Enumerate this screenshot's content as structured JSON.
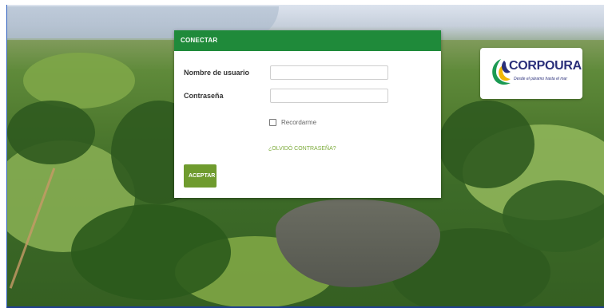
{
  "login": {
    "header": "CONECTAR",
    "username_label": "Nombre de usuario",
    "username_value": "",
    "password_label": "Contraseña",
    "password_value": "",
    "remember_label": "Recordarme",
    "forgot_link": "¿OLVIDÓ CONTRASEÑA?",
    "accept_button": "ACEPTAR"
  },
  "brand": {
    "name": "CORPOURABA",
    "tagline": "Desde el páramo hasta el mar"
  },
  "colors": {
    "header_green": "#1f8a3a",
    "button_green": "#6f9b2e",
    "link_green": "#7cab3b",
    "brand_blue": "#2a2f7a"
  }
}
